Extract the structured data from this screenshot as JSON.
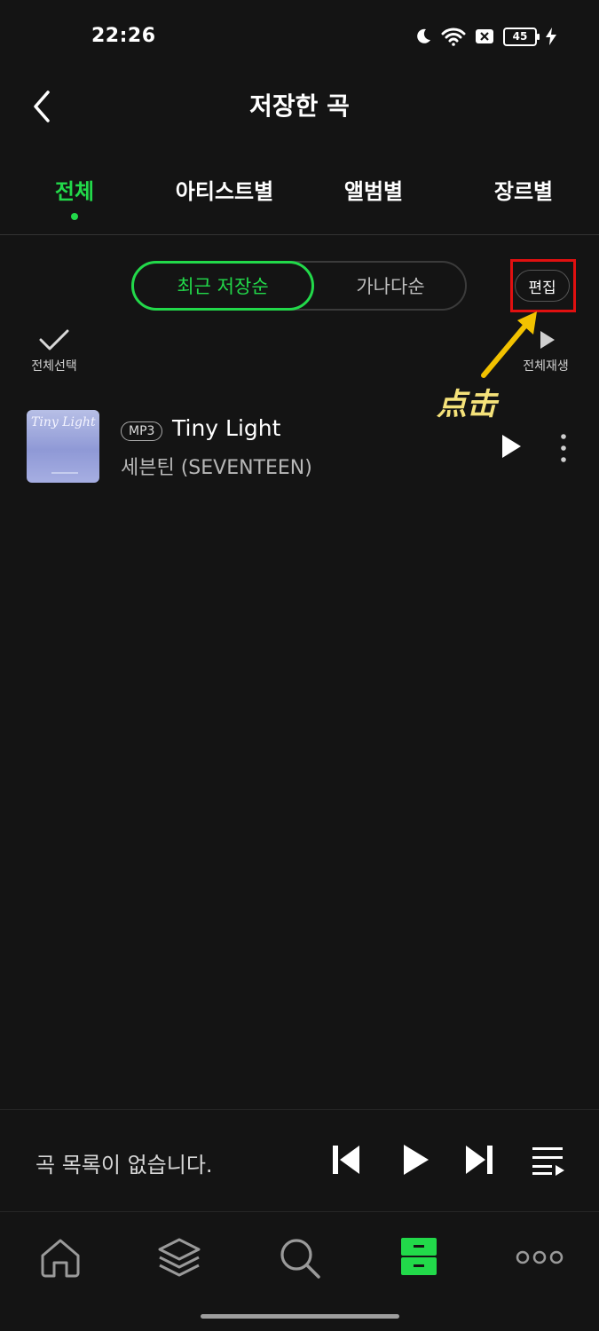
{
  "status_bar": {
    "time": "22:26",
    "battery_level": "45",
    "icons": [
      "moon-icon",
      "wifi-icon",
      "no-sim-icon",
      "battery-icon",
      "charging-bolt-icon"
    ]
  },
  "header": {
    "title": "저장한 곡",
    "back_icon": "chevron-left-icon"
  },
  "tabs": {
    "items": [
      {
        "label": "전체",
        "active": true
      },
      {
        "label": "아티스트별",
        "active": false
      },
      {
        "label": "앨범별",
        "active": false
      },
      {
        "label": "장르별",
        "active": false
      }
    ],
    "accent_color": "#22d94a"
  },
  "sort": {
    "options": [
      {
        "label": "최근 저장순",
        "selected": true
      },
      {
        "label": "가나다순",
        "selected": false
      }
    ]
  },
  "edit_button": {
    "label": "편집"
  },
  "select_all": {
    "label": "전체선택",
    "icon": "checkmark-icon"
  },
  "play_all": {
    "label": "전체재생",
    "icon": "play-icon"
  },
  "annotation": {
    "label": "点击",
    "highlight_color": "#e01010",
    "arrow_color": "#f2c200"
  },
  "songs": [
    {
      "album_art_text": "Tiny Light",
      "format": "MP3",
      "title": "Tiny Light",
      "artist": "세븐틴 (SEVENTEEN)"
    }
  ],
  "mini_player": {
    "status_text": "곡 목록이 없습니다.",
    "controls": [
      "skip-previous-icon",
      "play-icon",
      "skip-next-icon",
      "queue-list-icon"
    ]
  },
  "bottom_nav": {
    "items": [
      {
        "icon": "home-icon",
        "active": false
      },
      {
        "icon": "layers-icon",
        "active": false
      },
      {
        "icon": "search-icon",
        "active": false
      },
      {
        "icon": "storage-drawer-icon",
        "active": true
      },
      {
        "icon": "more-dots-icon",
        "active": false
      }
    ]
  }
}
